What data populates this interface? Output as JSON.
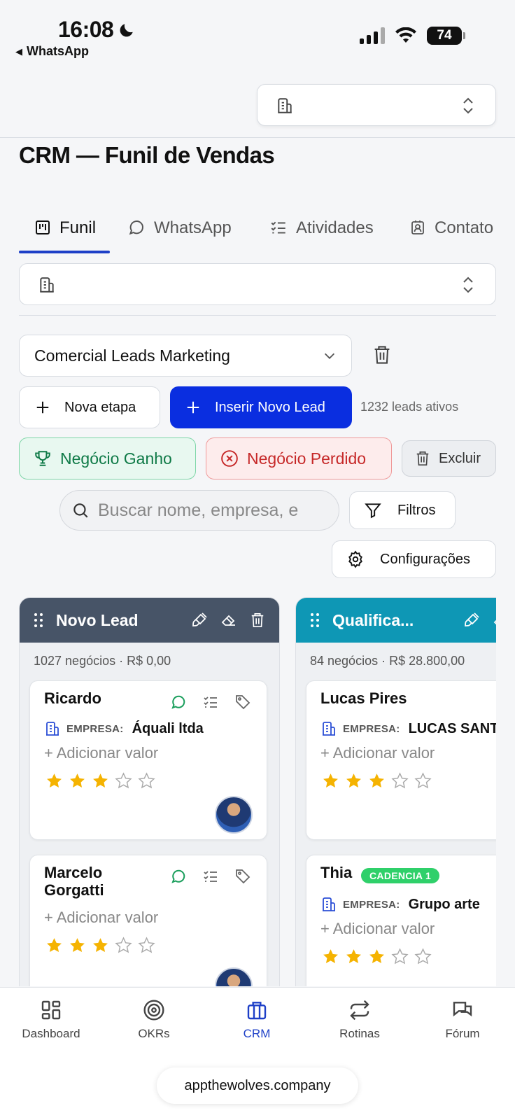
{
  "status_bar": {
    "time": "16:08",
    "back_app": "WhatsApp",
    "battery": "74"
  },
  "page": {
    "title": "CRM — Funil de Vendas"
  },
  "tabs": [
    {
      "label": "Funil",
      "icon": "kanban-icon",
      "active": true
    },
    {
      "label": "WhatsApp",
      "icon": "chat-icon",
      "active": false
    },
    {
      "label": "Atividades",
      "icon": "checklist-icon",
      "active": false
    },
    {
      "label": "Contato",
      "icon": "contact-icon",
      "active": false
    }
  ],
  "pipeline": {
    "selected": "Comercial Leads Marketing"
  },
  "actions": {
    "nova_etapa": "Nova etapa",
    "inserir_lead": "Inserir Novo Lead",
    "leads_ativos": "1232 leads ativos",
    "ganho": "Negócio Ganho",
    "perdido": "Negócio Perdido",
    "excluir": "Excluir",
    "filtros": "Filtros",
    "configuracoes": "Configurações"
  },
  "search": {
    "placeholder": "Buscar nome, empresa, e"
  },
  "columns": [
    {
      "title": "Novo Lead",
      "color": "#475467",
      "stats": "1027 negócios · R$ 0,00",
      "cards": [
        {
          "name": "Ricardo",
          "company_label": "EMPRESA:",
          "company": "Áquali ltda",
          "add_value": "+ Adicionar valor",
          "rating": 3
        },
        {
          "name": "Marcelo Gorgatti",
          "add_value": "+ Adicionar valor",
          "rating": 3
        }
      ]
    },
    {
      "title": "Qualifica...",
      "color": "#0e97b5",
      "stats": "84 negócios · R$ 28.800,00",
      "cards": [
        {
          "name": "Lucas Pires",
          "company_label": "EMPRESA:",
          "company": "LUCAS SANT",
          "add_value": "+ Adicionar valor",
          "rating": 3
        },
        {
          "name": "Thia",
          "badge": "CADENCIA 1",
          "company_label": "EMPRESA:",
          "company": "Grupo arte",
          "add_value": "+ Adicionar valor",
          "rating": 3
        }
      ]
    }
  ],
  "bottom_nav": [
    {
      "label": "Dashboard",
      "icon": "dashboard-icon",
      "active": false
    },
    {
      "label": "OKRs",
      "icon": "target-icon",
      "active": false
    },
    {
      "label": "CRM",
      "icon": "briefcase-icon",
      "active": true
    },
    {
      "label": "Rotinas",
      "icon": "repeat-icon",
      "active": false
    },
    {
      "label": "Fórum",
      "icon": "forum-icon",
      "active": false
    }
  ],
  "url": "appthewolves.company",
  "colors": {
    "primary": "#0a2ee0",
    "accent": "#1d3fc7",
    "star": "#f5b301",
    "success": "#0f7a47",
    "danger": "#c62828"
  }
}
